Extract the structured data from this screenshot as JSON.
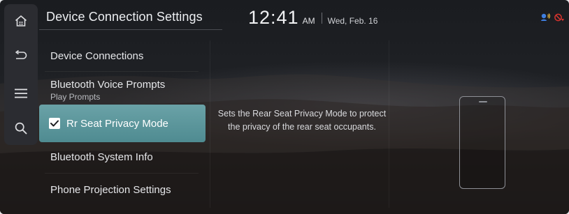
{
  "header": {
    "title": "Device Connection Settings",
    "time": "12:41",
    "ampm": "AM",
    "date": "Wed, Feb. 16"
  },
  "rail": {
    "icons": [
      "home-icon",
      "back-icon",
      "menu-icon",
      "search-icon"
    ]
  },
  "menu": {
    "items": [
      {
        "label": "Device Connections"
      },
      {
        "label": "Bluetooth Voice Prompts",
        "sub": "Play Prompts"
      },
      {
        "label": "Rr Seat Privacy Mode",
        "checked": true,
        "selected": true
      },
      {
        "label": "Bluetooth System Info"
      },
      {
        "label": "Phone Projection Settings"
      }
    ]
  },
  "description": "Sets the Rear Seat Privacy Mode to protect the privacy of the rear seat occupants.",
  "status_icons": [
    "bluetooth-voice-icon",
    "mic-muted-icon"
  ],
  "colors": {
    "selected_bg": "#5b959b",
    "background": "#1e1f23",
    "text": "#e6e7ea",
    "muted_icon": "#d6332e",
    "status_blue": "#3f7fe0"
  }
}
